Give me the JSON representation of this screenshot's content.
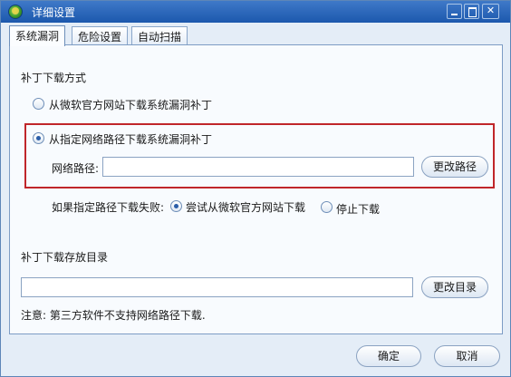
{
  "window": {
    "title": "详细设置"
  },
  "tabs": [
    {
      "label": "系统漏洞",
      "active": true
    },
    {
      "label": "危险设置",
      "active": false
    },
    {
      "label": "自动扫描",
      "active": false
    }
  ],
  "patch_download": {
    "section_title": "补丁下载方式",
    "option_official": {
      "label": "从微软官方网站下载系统漏洞补丁",
      "checked": false
    },
    "option_custom": {
      "label": "从指定网络路径下载系统漏洞补丁",
      "checked": true
    },
    "network_path_label": "网络路径:",
    "network_path_value": "",
    "change_path_button": "更改路径",
    "fallback_label": "如果指定路径下载失败:",
    "fallback_try_official": {
      "label": "尝试从微软官方网站下载",
      "checked": true
    },
    "fallback_stop": {
      "label": "停止下载",
      "checked": false
    }
  },
  "storage": {
    "section_title": "补丁下载存放目录",
    "directory_value": "",
    "change_dir_button": "更改目录"
  },
  "note": "注意: 第三方软件不支持网络路径下载.",
  "footer": {
    "ok_label": "确定",
    "cancel_label": "取消"
  },
  "colors": {
    "titlebar": "#1c58ad",
    "highlight_border": "#c0262a",
    "window_bg": "#e4edf7"
  }
}
